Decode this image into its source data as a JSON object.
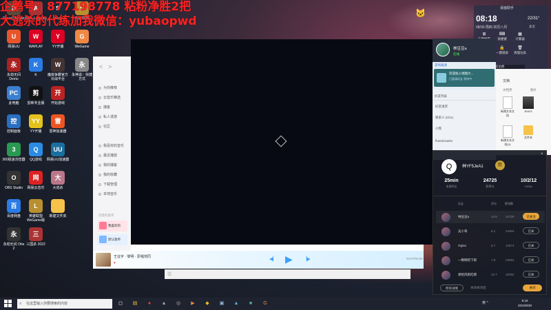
{
  "overlay": {
    "line1": "企鹅号：877198778  粘粉净胜2把",
    "line2": "大逃杀的代练加我微信：yubaopwd"
  },
  "desktop_icons": [
    {
      "label": "Dread Hunger",
      "glyph": "D",
      "color": "#5a4b3a"
    },
    {
      "label": "Apex Legends",
      "glyph": "A",
      "color": "#a33"
    },
    {
      "label": "Steam",
      "glyph": "S",
      "color": "#1b2838"
    },
    {
      "label": "英雄联盟",
      "glyph": "L",
      "color": "#b8902f"
    },
    {
      "label": "网易UU",
      "glyph": "U",
      "color": "#e8552a"
    },
    {
      "label": "WAPLAY",
      "glyph": "W",
      "color": "#d02"
    },
    {
      "label": "YY开播",
      "glyph": "Y",
      "color": "#d02"
    },
    {
      "label": "WeGame",
      "glyph": "G",
      "color": "#e84"
    },
    {
      "label": "永劫无间 Demo",
      "glyph": "永",
      "color": "#a22"
    },
    {
      "label": "K",
      "glyph": "K",
      "color": "#2a7be4"
    },
    {
      "label": "魔兽争霸官方对战平台",
      "glyph": "W",
      "color": "#433"
    },
    {
      "label": "永神说：快捷方式",
      "glyph": "永",
      "color": "#888"
    },
    {
      "label": "此电脑",
      "glyph": "PC",
      "color": "#3c7fd0"
    },
    {
      "label": "剪映专业版",
      "glyph": "剪",
      "color": "#111"
    },
    {
      "label": "开始游戏",
      "glyph": "开",
      "color": "#b22"
    },
    {
      "label": "PUBG",
      "glyph": "P",
      "color": "#b62"
    },
    {
      "label": "控制面板",
      "glyph": "控",
      "color": "#2a6fc0"
    },
    {
      "label": "YY开播",
      "glyph": "YY",
      "color": "#e5c21c"
    },
    {
      "label": "雷神加速器",
      "glyph": "雷",
      "color": "#e52"
    },
    {
      "label": "腾讯QQ",
      "glyph": "Q",
      "color": "#2a8ce4"
    },
    {
      "label": "360极速浏览器",
      "glyph": "3",
      "color": "#2a9a52"
    },
    {
      "label": "QQ游戏",
      "glyph": "Q",
      "color": "#2a8ce4"
    },
    {
      "label": "网易UU加速器",
      "glyph": "UU",
      "color": "#1a6fa0"
    },
    {
      "label": "回收站",
      "glyph": "回",
      "color": "#6a88aa"
    },
    {
      "label": "OBS Studio",
      "glyph": "O",
      "color": "#333"
    },
    {
      "label": "网易云音乐",
      "glyph": "网",
      "color": "#d22"
    },
    {
      "label": "大逃杀",
      "glyph": "大",
      "color": "#b78"
    },
    {
      "label": "YY直播",
      "glyph": "YY",
      "color": "#e5c21c"
    },
    {
      "label": "百度网盘",
      "glyph": "百",
      "color": "#2a7be4"
    },
    {
      "label": "英雄联盟WeGame版",
      "glyph": "L",
      "color": "#b8902f"
    },
    {
      "label": "新建文件夹",
      "glyph": "",
      "color": "#f5c24a"
    },
    {
      "label": "英雄联盟",
      "glyph": "L",
      "color": "#b8902f"
    },
    {
      "label": "永劫无间 Ohe 2",
      "glyph": "永",
      "color": "#333"
    },
    {
      "label": "三国杀 2022",
      "glyph": "三",
      "color": "#a33"
    }
  ],
  "music": {
    "nav": [
      "<",
      ">"
    ],
    "sidebar": [
      "为你推荐",
      "云音乐精选",
      "播客",
      "私人漫游",
      "社区",
      "",
      "我喜欢的音乐",
      "最近播放",
      "我的播客",
      "我的收藏",
      "下载管理",
      "本地音乐"
    ],
    "section_title": "创建的歌单",
    "playlists": [
      {
        "label": "我喜欢的",
        "color": "#ff7a94"
      },
      {
        "label": "默认歌单",
        "color": "#7fb8ff"
      }
    ],
    "song_title": "王征宇 · 黎明 · 原唱地同",
    "song_artist": "♥",
    "time": "02:07/04:00"
  },
  "widget": {
    "title": "桌面助手",
    "time": "08:18",
    "date": "08/30 周四 农历八月",
    "temp": "22/31°",
    "weather": "多云",
    "buttons": [
      "应用推荐",
      "快捷键",
      "计算器",
      "截图",
      "一键锁屏",
      "清理垃圾"
    ],
    "bar": "进入直播，秒变伯爵"
  },
  "qq": {
    "name": "林豆豆a",
    "status": "在线",
    "notice_title": "游戏邀请",
    "notice_card": "欢迎加入地图大...",
    "notice_sub": "已邀请好友 等待中",
    "tabs": "好友列表",
    "items": [
      "好友请求",
      "联系人 (0/11)",
      "小熊",
      "fhasdvsaahs"
    ]
  },
  "files": {
    "heading": "文档",
    "col1": "文档夹",
    "col2": "图片",
    "items": [
      {
        "label": "新建文本文档",
        "type": "doc"
      },
      {
        "label": "80403",
        "type": "photo"
      },
      {
        "label": "新建文本文档(3)",
        "type": "doc"
      },
      {
        "label": "文件夹",
        "type": "folder"
      }
    ]
  },
  "game": {
    "close": "×",
    "avatar": "Q",
    "name": "林YF5JeA1",
    "rank": "胜",
    "stats": [
      {
        "value": "25min",
        "label": "本局时长"
      },
      {
        "value": "24725",
        "label": "胜率分"
      },
      {
        "value": "10/2/12",
        "label": "K/D/A"
      }
    ],
    "col_labels": [
      "队友",
      "评分",
      "胜场数"
    ],
    "players": [
      {
        "name": "林豆豆a",
        "score": "14.6",
        "points": "24725",
        "action": "已关注",
        "primary": true
      },
      {
        "name": "吴小哥",
        "score": "8.1",
        "points": "24464",
        "action": "已关",
        "primary": false
      },
      {
        "name": "Ogine",
        "score": "6.7",
        "points": "12874",
        "action": "已关",
        "primary": false
      },
      {
        "name": "一颗网吧下雨",
        "score": "7.9",
        "points": "23053",
        "action": "已关",
        "primary": false
      },
      {
        "name": "想给风跑吃猪",
        "score": "12.7",
        "points": "23252",
        "action": "已关",
        "primary": false
      }
    ],
    "footer_left": "所有详情",
    "footer_mid": "本场关闭团",
    "footer_right": "关闭"
  },
  "taskbar": {
    "search_placeholder": "在这里输入你要搜索的内容",
    "time": "8:18",
    "date": "2022/8/30",
    "tray": "英 ^",
    "apps": [
      {
        "name": "task-view-icon",
        "glyph": "◻",
        "color": "#fff",
        "bg": "transparent"
      },
      {
        "name": "folder-icon",
        "glyph": "▤",
        "color": "#f5c24a",
        "bg": "transparent"
      },
      {
        "name": "chrome-icon",
        "glyph": "●",
        "color": "#e44",
        "bg": "transparent"
      },
      {
        "name": "app-icon-a",
        "glyph": "▲",
        "color": "#aaa",
        "bg": "transparent"
      },
      {
        "name": "app-icon-b",
        "glyph": "◎",
        "color": "#bbb",
        "bg": "transparent"
      },
      {
        "name": "app-icon-c",
        "glyph": "▶",
        "color": "#e84",
        "bg": "transparent"
      },
      {
        "name": "app-icon-d",
        "glyph": "◆",
        "color": "#e5c21c",
        "bg": "transparent"
      },
      {
        "name": "app-icon-e",
        "glyph": "▣",
        "color": "#9bd",
        "bg": "transparent"
      },
      {
        "name": "app-icon-f",
        "glyph": "▲",
        "color": "#6bd",
        "bg": "transparent"
      },
      {
        "name": "app-icon-g",
        "glyph": "■",
        "color": "#5a8",
        "bg": "transparent"
      },
      {
        "name": "app-icon-h",
        "glyph": "G",
        "color": "#e84",
        "bg": "transparent"
      }
    ]
  }
}
